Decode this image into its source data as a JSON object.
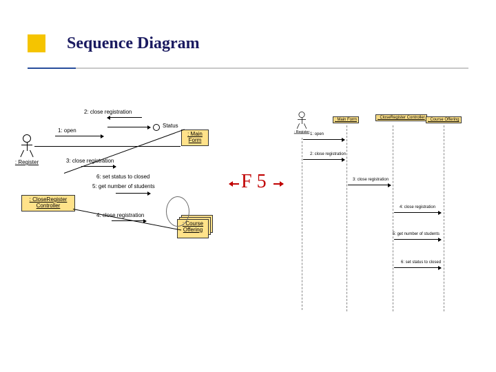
{
  "title": "Sequence Diagram",
  "center_key": "F 5",
  "left_diagram": {
    "actor": ": Register",
    "main_form": ": Main Form",
    "controller": ": CloseRegister Controller",
    "course_offering": ": Course Offering",
    "status_label": "Status",
    "messages": {
      "m1": "1: open",
      "m2": "2: close registration",
      "m3": "3: close registration",
      "m4": "4: close registration",
      "m5": "5: get number of students",
      "m6": "6: set status to closed"
    }
  },
  "right_diagram": {
    "actor": ": Register",
    "lifelines": [
      ": Main Form",
      ": CloseRegister Controller",
      ": Course Offering"
    ],
    "messages": {
      "m1": "1: open",
      "m2": "2: close registration",
      "m3": "3: close registration",
      "m4": "4: close registration",
      "m5": "5: get number of students",
      "m6": "6: set status to closed"
    }
  }
}
